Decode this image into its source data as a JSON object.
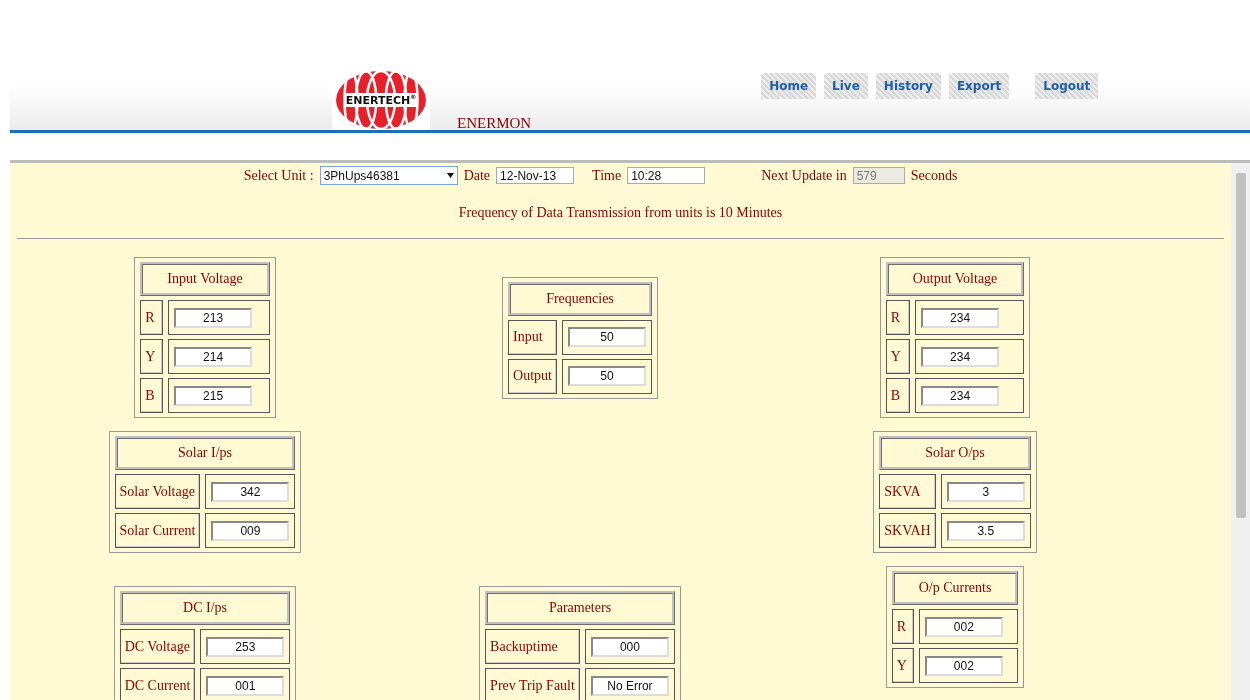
{
  "logo": {
    "text": "ENERTECH$^{®}$"
  },
  "app_name": "ENERMON",
  "nav": [
    {
      "label": "Home",
      "selected": false
    },
    {
      "label": "Live",
      "selected": false
    },
    {
      "label": "History",
      "selected": false
    },
    {
      "label": "Export",
      "selected": false
    },
    {
      "label": "Logout",
      "selected": false
    }
  ],
  "filters": {
    "unit_label": "Select Unit :",
    "unit_value": "3PhUps46381",
    "date_label": "Date",
    "date_value": "12-Nov-13",
    "time_label": "Time",
    "time_value": "10:28",
    "update_label": "Next Update in",
    "update_value": "579",
    "update_unit": "Seconds"
  },
  "note": "Frequency of Data Transmission from units is 10 Minutes",
  "panels": [
    {
      "title": "Input Voltage",
      "rows": [
        {
          "label": "R",
          "value": "213"
        },
        {
          "label": "Y",
          "value": "214"
        },
        {
          "label": "B",
          "value": "215"
        }
      ]
    },
    {
      "title": "Frequencies",
      "rows": [
        {
          "label": "Input",
          "value": "50"
        },
        {
          "label": "Output",
          "value": "50"
        }
      ]
    },
    {
      "title": "Output Voltage",
      "rows": [
        {
          "label": "R",
          "value": "234"
        },
        {
          "label": "Y",
          "value": "234"
        },
        {
          "label": "B",
          "value": "234"
        }
      ]
    },
    {
      "title": "Solar I/ps",
      "rows": [
        {
          "label": "Solar Voltage",
          "value": "342"
        },
        {
          "label": "Solar Current",
          "value": "009"
        }
      ]
    },
    {
      "title": "Solar O/ps",
      "rows": [
        {
          "label": "SKVA",
          "value": "3"
        },
        {
          "label": "SKVAH",
          "value": "3.5"
        }
      ]
    },
    {
      "title": "DC I/ps",
      "rows": [
        {
          "label": "DC Voltage",
          "value": "253"
        },
        {
          "label": "DC Current",
          "value": "001"
        }
      ]
    },
    {
      "title": "Parameters",
      "rows": [
        {
          "label": "Backuptime",
          "value": "000"
        },
        {
          "label": "Prev Trip Fault",
          "value": "No Error"
        }
      ]
    },
    {
      "title": "O/p Currents",
      "rows": [
        {
          "label": "R",
          "value": "002"
        },
        {
          "label": "Y",
          "value": "002"
        }
      ]
    }
  ]
}
